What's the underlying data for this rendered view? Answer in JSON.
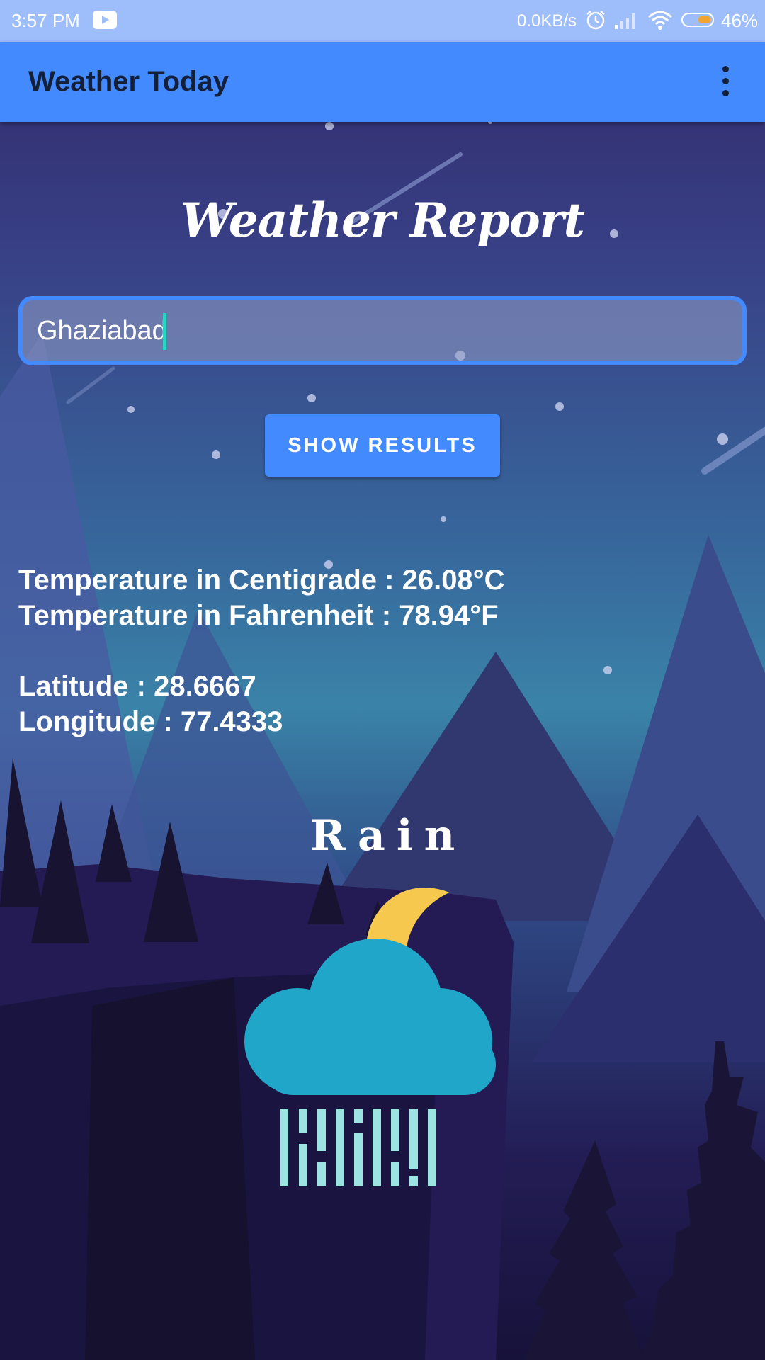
{
  "status_bar": {
    "time": "3:57 PM",
    "network_speed": "0.0KB/s",
    "battery_percent": "46%",
    "battery_level": 0.46,
    "icons": [
      "youtube-icon",
      "alarm-icon",
      "signal-icon",
      "wifi-icon",
      "battery-icon"
    ]
  },
  "app_bar": {
    "title": "Weather Today",
    "menu_icon": "more-vert-icon"
  },
  "main": {
    "heading": "Weather Report",
    "city_input": {
      "value": "Ghaziabad",
      "placeholder": ""
    },
    "show_results_label": "SHOW RESULTS",
    "results": {
      "temp_c": "Temperature in Centigrade : 26.08°C",
      "temp_f": "Temperature in Fahrenheit : 78.94°F",
      "latitude": "Latitude : 28.6667",
      "longitude": "Longitude : 77.4333"
    },
    "condition": "Rain",
    "condition_icon": "rain-night-icon"
  },
  "colors": {
    "primary": "#448aff",
    "status_bar": "#9ebdfb",
    "cloud": "#20a6c8",
    "moon": "#f6c94e",
    "rain": "#9ce3e1",
    "caret": "#2bd3c4"
  }
}
